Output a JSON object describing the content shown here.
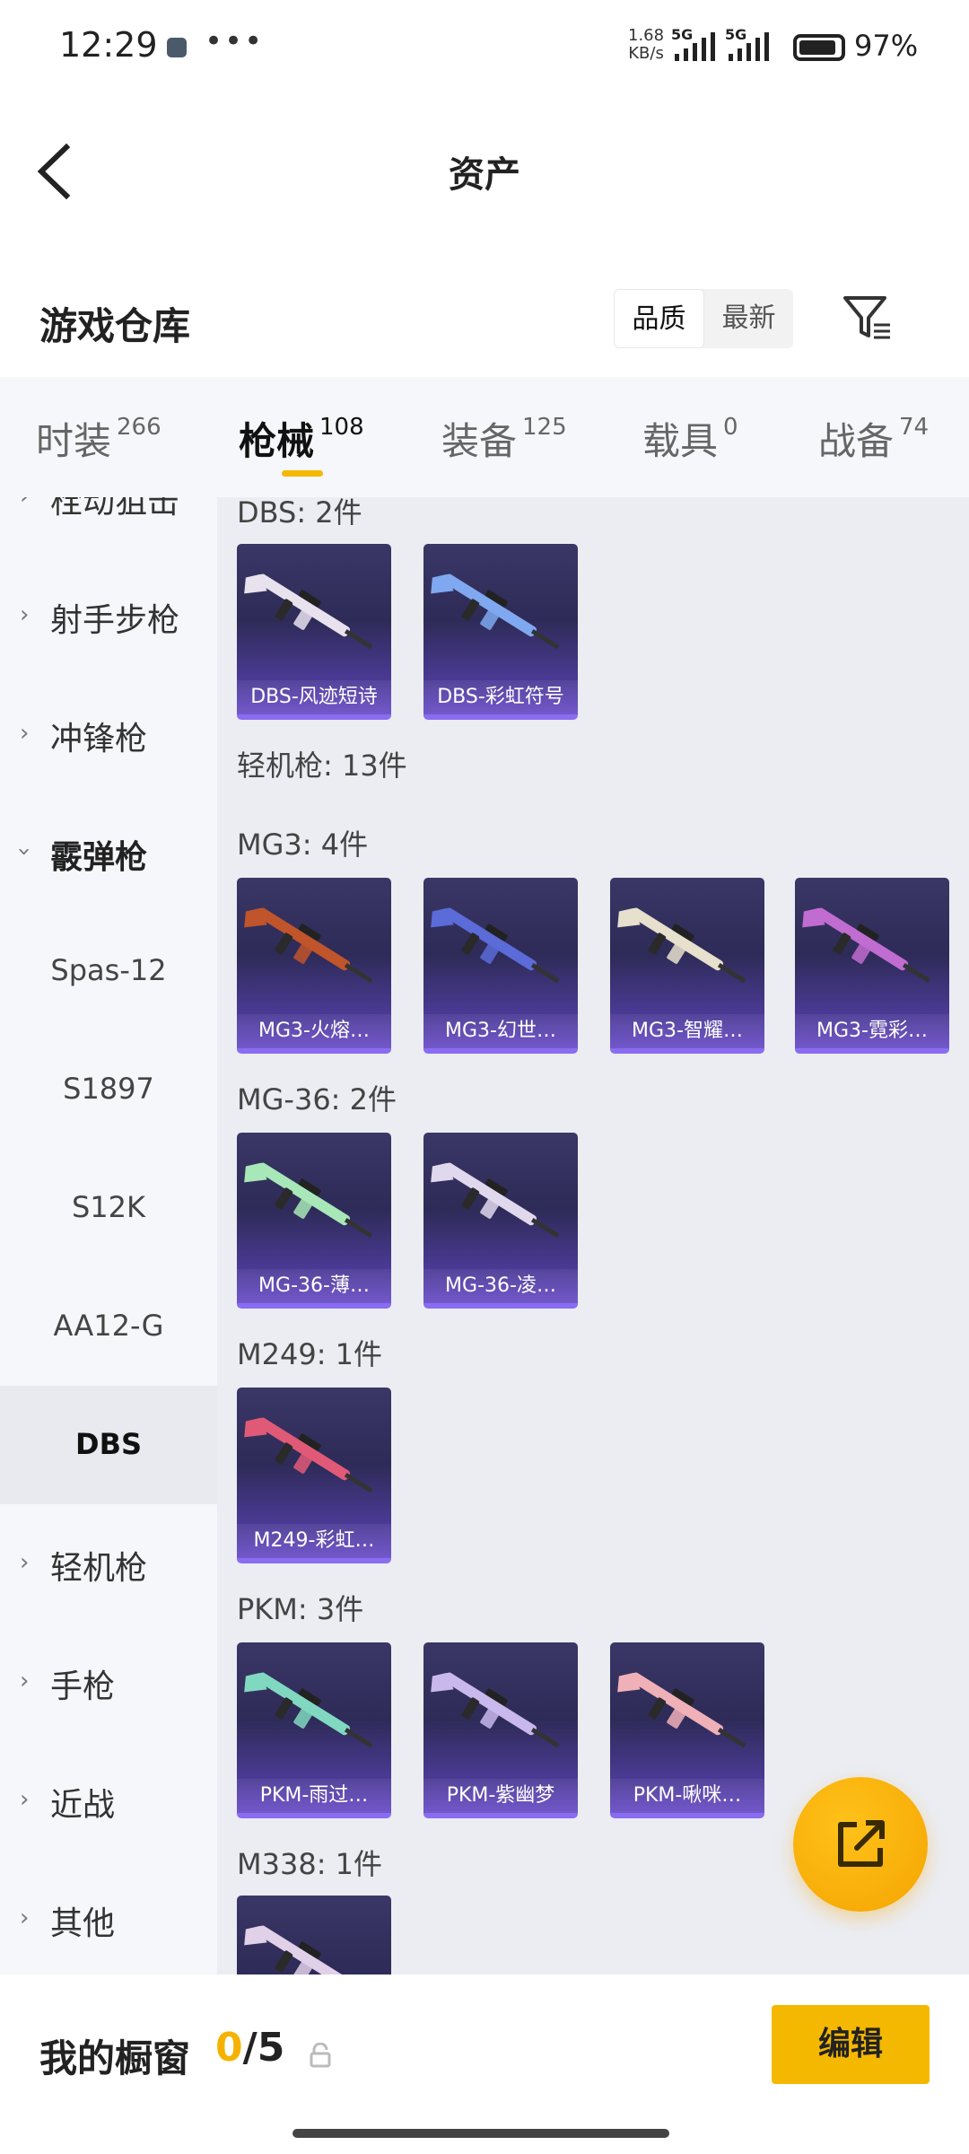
{
  "status": {
    "time": "12:29",
    "net_speed_value": "1.68",
    "net_speed_unit": "KB/s",
    "network1": "5G",
    "network2": "5G",
    "battery": "97%"
  },
  "header": {
    "title": "资产"
  },
  "warehouse": {
    "title": "游戏仓库",
    "sort_options": [
      "品质",
      "最新"
    ],
    "sort_selected": "品质"
  },
  "tabs": [
    {
      "label": "时装",
      "count": "266"
    },
    {
      "label": "枪械",
      "count": "108",
      "selected": true
    },
    {
      "label": "装备",
      "count": "125"
    },
    {
      "label": "载具",
      "count": "0"
    },
    {
      "label": "战备",
      "count": "74"
    }
  ],
  "sidebar": [
    {
      "label": "栓动狙击",
      "expand": "collapsed"
    },
    {
      "label": "射手步枪",
      "expand": "collapsed"
    },
    {
      "label": "冲锋枪",
      "expand": "collapsed"
    },
    {
      "label": "霰弹枪",
      "expand": "expanded"
    },
    {
      "label": "Spas-12",
      "sub": true
    },
    {
      "label": "S1897",
      "sub": true
    },
    {
      "label": "S12K",
      "sub": true
    },
    {
      "label": "AA12-G",
      "sub": true
    },
    {
      "label": "DBS",
      "sub": true,
      "selected": true
    },
    {
      "label": "轻机枪",
      "expand": "collapsed"
    },
    {
      "label": "手枪",
      "expand": "collapsed"
    },
    {
      "label": "近战",
      "expand": "collapsed"
    },
    {
      "label": "其他",
      "expand": "collapsed"
    }
  ],
  "groups": [
    {
      "heading": "DBS: 2件",
      "items": [
        {
          "name": "DBS-风迹短诗",
          "tint": "#e8e2ee"
        },
        {
          "name": "DBS-彩虹符号",
          "tint": "#7fa8f0"
        }
      ]
    },
    {
      "heading": "轻机枪: 13件",
      "items": []
    },
    {
      "heading": "MG3: 4件",
      "items": [
        {
          "name": "MG3-火熔…",
          "tint": "#c0542a"
        },
        {
          "name": "MG3-幻世…",
          "tint": "#5b6bd8"
        },
        {
          "name": "MG3-智耀…",
          "tint": "#e6e0cc"
        },
        {
          "name": "MG3-霓彩…",
          "tint": "#c06cd0"
        }
      ]
    },
    {
      "heading": "MG-36: 2件",
      "items": [
        {
          "name": "MG-36-薄…",
          "tint": "#a8e8b8"
        },
        {
          "name": "MG-36-凌…",
          "tint": "#e0d8ec"
        }
      ]
    },
    {
      "heading": "M249: 1件",
      "items": [
        {
          "name": "M249-彩虹…",
          "tint": "#e05a78"
        }
      ]
    },
    {
      "heading": "PKM: 3件",
      "items": [
        {
          "name": "PKM-雨过…",
          "tint": "#80d8c0"
        },
        {
          "name": "PKM-紫幽梦",
          "tint": "#c8b8ec"
        },
        {
          "name": "PKM-啾咪…",
          "tint": "#f0b0b8"
        }
      ]
    },
    {
      "heading": "M338: 1件",
      "items": [
        {
          "name": "",
          "tint": "#e0d0e8"
        }
      ]
    }
  ],
  "showcase": {
    "label": "我的橱窗",
    "current": "0",
    "max": "/5",
    "edit_label": "编辑"
  },
  "colors": {
    "accent": "#f5b800",
    "card_bg": "#2e2b58",
    "card_border": "#8a6cf0"
  }
}
